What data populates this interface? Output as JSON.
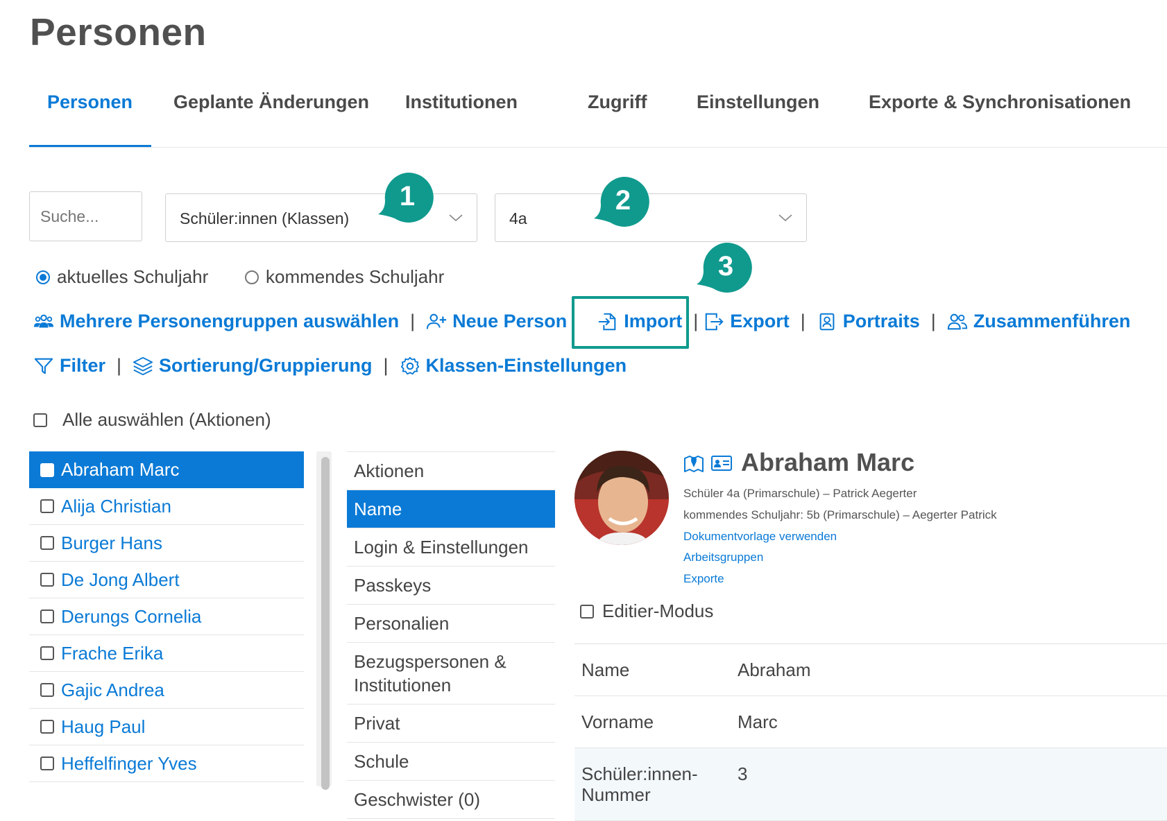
{
  "page": {
    "title": "Personen"
  },
  "tabs": [
    {
      "label": "Personen"
    },
    {
      "label": "Geplante Änderungen"
    },
    {
      "label": "Institutionen"
    },
    {
      "label": "Zugriff"
    },
    {
      "label": "Einstellungen"
    },
    {
      "label": "Exporte & Synchronisationen"
    }
  ],
  "filters": {
    "search_placeholder": "Suche...",
    "group_select": "Schüler:innen (Klassen)",
    "class_select": "4a"
  },
  "callouts": [
    "1",
    "2",
    "3"
  ],
  "school_year": {
    "current": "aktuelles Schuljahr",
    "next": "kommendes Schuljahr"
  },
  "actions": {
    "multi_group": "Mehrere Personengruppen auswählen",
    "new_person": "Neue Person",
    "import": "Import",
    "export": "Export",
    "portraits": "Portraits",
    "merge": "Zusammenführen",
    "filter": "Filter",
    "sort_group": "Sortierung/Gruppierung",
    "class_settings": "Klassen-Einstellungen",
    "separator": "|"
  },
  "select_all": "Alle auswählen (Aktionen)",
  "persons": [
    "Abraham Marc",
    "Alija Christian",
    "Burger Hans",
    "De Jong Albert",
    "Derungs Cornelia",
    "Frache Erika",
    "Gajic Andrea",
    "Haug Paul",
    "Heffelfinger Yves"
  ],
  "sections": [
    "Aktionen",
    "Name",
    "Login & Einstellungen",
    "Passkeys",
    "Personalien",
    "Bezugspersonen & Institutionen",
    "Privat",
    "Schule",
    "Geschwister (0)"
  ],
  "detail": {
    "name": "Abraham Marc",
    "line1": "Schüler 4a (Primarschule) – Patrick Aegerter",
    "line2": "kommendes Schuljahr: 5b (Primarschule) – Aegerter Patrick",
    "links": [
      "Dokumentvorlage verwenden",
      "Arbeitsgruppen",
      "Exporte"
    ],
    "edit_mode": "Editier-Modus",
    "fields": [
      {
        "label": "Name",
        "value": "Abraham"
      },
      {
        "label": "Vorname",
        "value": "Marc"
      },
      {
        "label": "Schüler:innen-Nummer",
        "value": "3"
      }
    ]
  },
  "colors": {
    "accent": "#0a7ad6",
    "callout": "#109a8e"
  }
}
